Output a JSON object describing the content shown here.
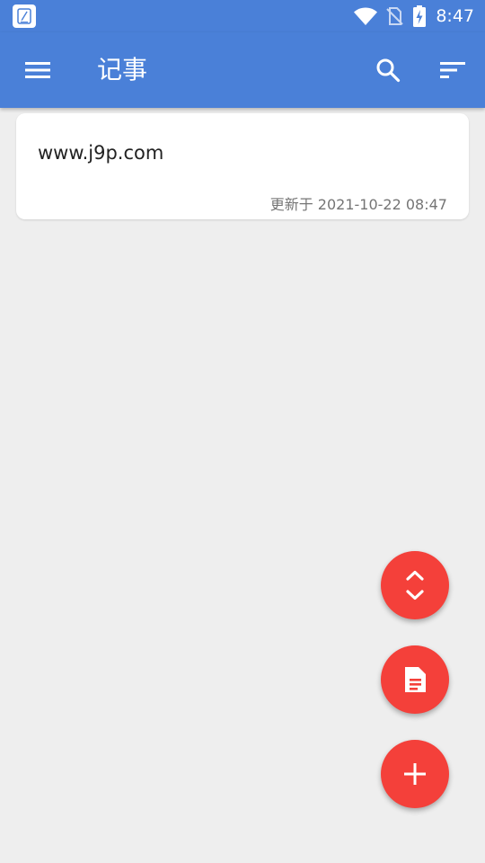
{
  "status_bar": {
    "time": "8:47",
    "icons": [
      "app-notification-icon",
      "wifi-icon",
      "no-sim-icon",
      "battery-charging-icon"
    ]
  },
  "app_bar": {
    "title": "记事",
    "icons": [
      "menu-icon",
      "search-icon",
      "sort-icon"
    ]
  },
  "notes": [
    {
      "title": "www.j9p.com",
      "updated": "更新于 2021-10-22 08:47"
    }
  ],
  "fabs": {
    "icons": [
      "unfold-icon",
      "document-icon",
      "plus-icon"
    ]
  },
  "colors": {
    "primary": "#4a80d8",
    "background": "#eeeeee",
    "card": "#ffffff",
    "accent": "#f4403a",
    "title_text": "#ffffff",
    "note_text": "#222222",
    "meta_text": "#757575"
  }
}
